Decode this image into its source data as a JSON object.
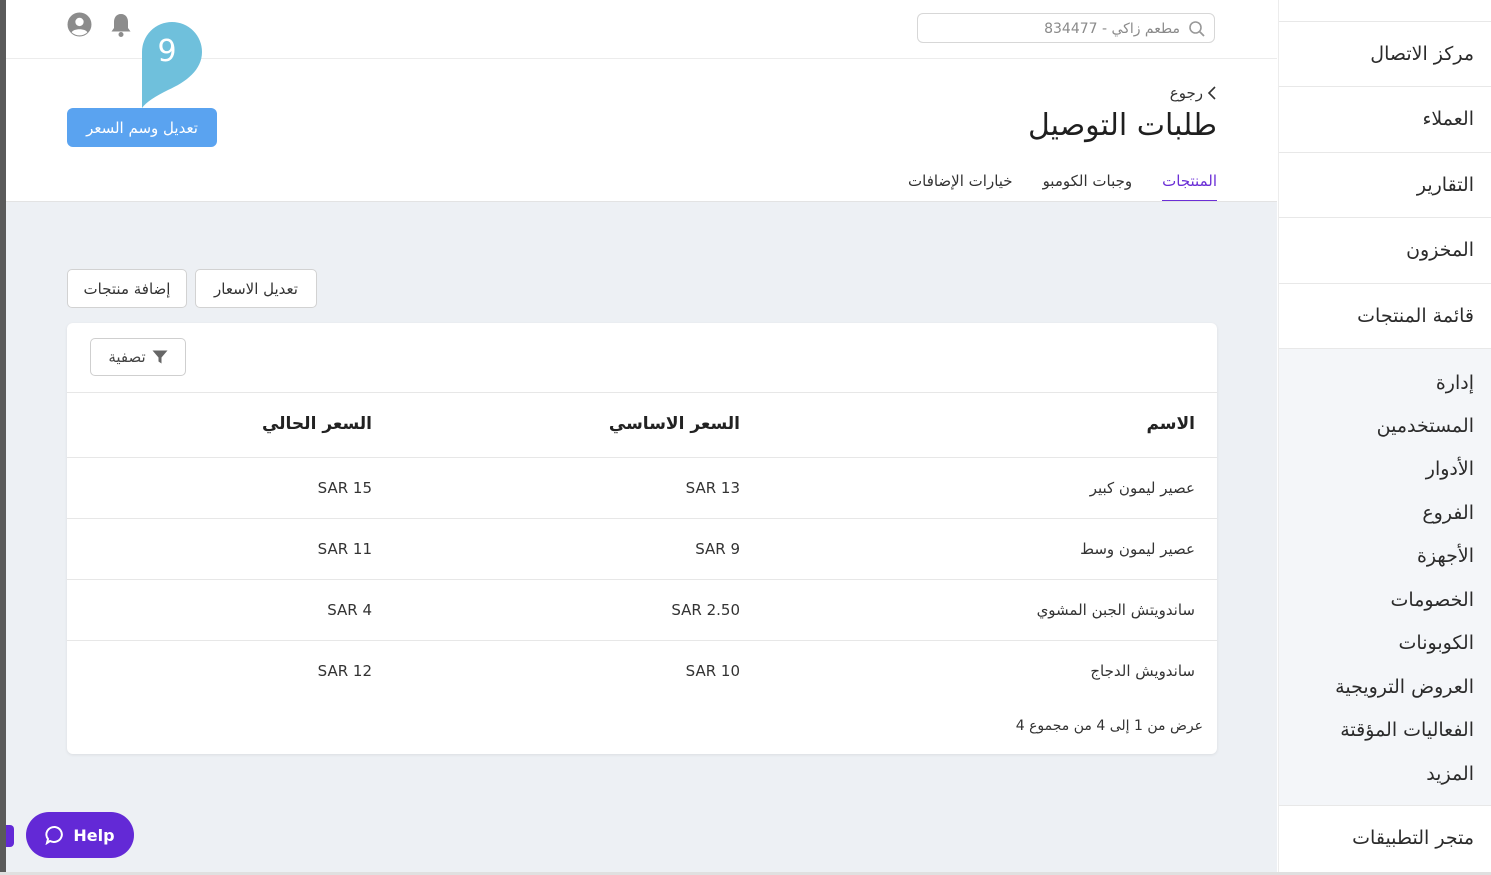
{
  "header": {
    "search_placeholder": "مطعم زاكي - 834477",
    "icons": [
      "user-icon",
      "bell-icon",
      "search-icon"
    ]
  },
  "page": {
    "back_label": "رجوع",
    "title": "طلبات التوصيل",
    "edit_tag_label": "تعديل وسم السعر",
    "bubble_number": "9",
    "tabs": [
      {
        "label": "المنتجات",
        "active": true
      },
      {
        "label": "وجبات الكومبو",
        "active": false
      },
      {
        "label": "خيارات الإضافات",
        "active": false
      }
    ]
  },
  "actions": {
    "edit_prices": "تعديل الاسعار",
    "add_products": "إضافة منتجات",
    "filter": "تصفية"
  },
  "table": {
    "headers": {
      "name": "الاسم",
      "base_price": "السعر الاساسي",
      "current_price": "السعر الحالي"
    },
    "rows": [
      {
        "name": "عصير ليمون كبير",
        "base_price": "SAR 13",
        "current_price": "SAR 15"
      },
      {
        "name": "عصير ليمون وسط",
        "base_price": "SAR 9",
        "current_price": "SAR 11"
      },
      {
        "name": "ساندويتش الجبن المشوي",
        "base_price": "SAR 2.50",
        "current_price": "SAR 4"
      },
      {
        "name": "ساندويش الدجاج",
        "base_price": "SAR 10",
        "current_price": "SAR 12"
      }
    ],
    "pagination": "عرض من 1 إلى 4 من مجموع 4"
  },
  "sidebar": {
    "top_items": [
      "مركز الاتصال",
      "العملاء",
      "التقارير",
      "المخزون",
      "قائمة المنتجات"
    ],
    "group_title": "إدارة",
    "sub_items": [
      "المستخدمين",
      "الأدوار",
      "الفروع",
      "الأجهزة",
      "الخصومات",
      "الكوبونات",
      "العروض الترويجية",
      "الفعاليات المؤقتة",
      "المزيد"
    ],
    "bottom_item": "متجر التطبيقات"
  },
  "help": {
    "label": "Help"
  },
  "colors": {
    "accent": "#6b2fd6",
    "primary_button": "#5aa3f0",
    "help_button": "#6329d6",
    "bubble": "#6fc0dc"
  }
}
